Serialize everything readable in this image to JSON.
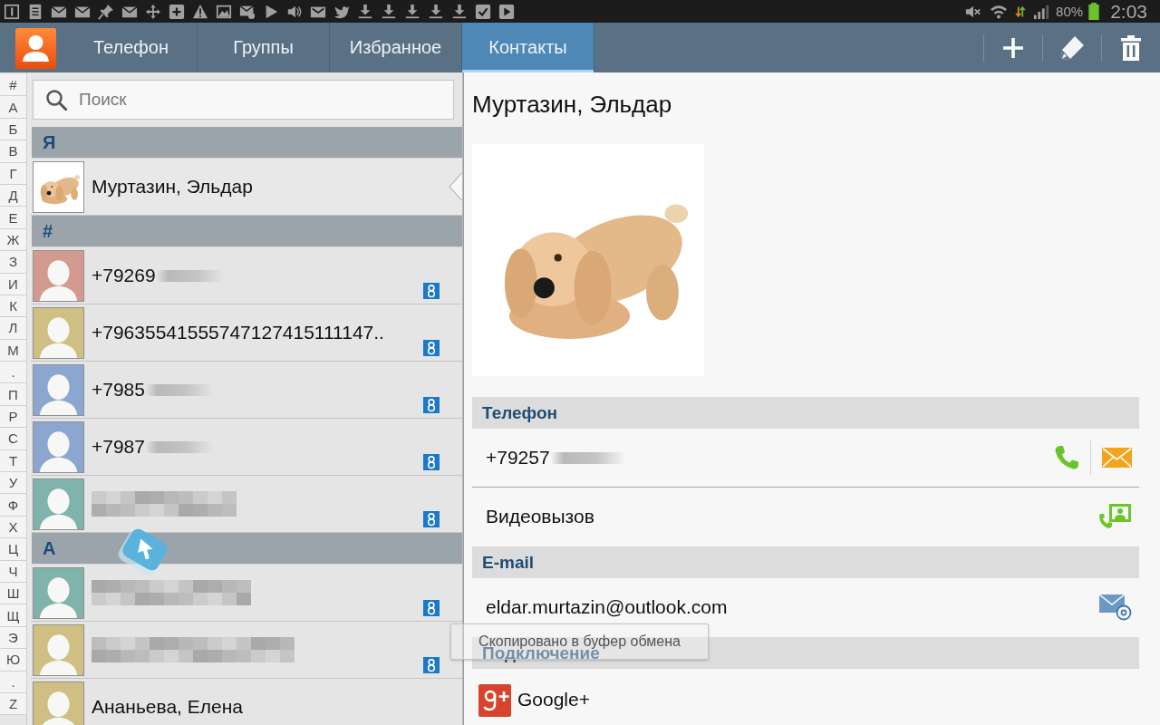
{
  "status_bar": {
    "battery": "80%",
    "time": "2:03"
  },
  "action_bar": {
    "tabs": [
      {
        "label": "Телефон",
        "selected": false
      },
      {
        "label": "Группы",
        "selected": false
      },
      {
        "label": "Избранное",
        "selected": false
      },
      {
        "label": "Контакты",
        "selected": true
      }
    ]
  },
  "index_bar": {
    "letters": [
      "#",
      "А",
      "Б",
      "В",
      "Г",
      "Д",
      "Е",
      "Ж",
      "З",
      "И",
      "К",
      "Л",
      "М",
      ".",
      "П",
      "Р",
      "С",
      "Т",
      "У",
      "Ф",
      "Х",
      "Ц",
      "Ч",
      "Ш",
      "Щ",
      "Э",
      "Ю",
      ".",
      "Z"
    ]
  },
  "contact_list": {
    "search": {
      "placeholder": "Поиск"
    },
    "sections": [
      {
        "header": "Я",
        "contacts": [
          {
            "kind": "photo",
            "name": "Муртазин, Эльдар",
            "blurred": false,
            "pixelated": false,
            "google": false,
            "selected": true
          }
        ]
      },
      {
        "header": "#",
        "contacts": [
          {
            "kind": "silhouette",
            "color": "#d39a8f",
            "name": "+79269",
            "blurred": true,
            "pixelated": false,
            "google": true,
            "selected": false
          },
          {
            "kind": "silhouette",
            "color": "#cfbf83",
            "name": "+79635541555747127415111147..",
            "blurred": false,
            "pixelated": false,
            "google": true,
            "selected": false
          },
          {
            "kind": "silhouette",
            "color": "#8ca7cf",
            "name": "+7985",
            "blurred": true,
            "pixelated": false,
            "google": true,
            "selected": false
          },
          {
            "kind": "silhouette",
            "color": "#8ca7cf",
            "name": "+7987",
            "blurred": true,
            "pixelated": false,
            "google": true,
            "selected": false
          },
          {
            "kind": "silhouette",
            "color": "#80b3ab",
            "blurred": false,
            "pixelated": true,
            "google": true,
            "selected": false
          }
        ]
      },
      {
        "header": "А",
        "contacts": [
          {
            "kind": "silhouette",
            "color": "#80b3ab",
            "blurred": false,
            "pixelated": true,
            "google": true,
            "selected": false
          },
          {
            "kind": "silhouette",
            "color": "#cfbf83",
            "blurred": false,
            "pixelated": true,
            "google": true,
            "selected": false
          },
          {
            "kind": "silhouette",
            "color": "#cfbf83",
            "name": "Ананьева, Елена",
            "blurred": false,
            "pixelated": false,
            "google": false,
            "selected": false
          }
        ]
      }
    ]
  },
  "contact_detail": {
    "title": "Муртазин, Эльдар",
    "sections": [
      {
        "title": "Телефон",
        "items": [
          {
            "kind": "phone",
            "value": "+79257",
            "blurred": true
          },
          {
            "kind": "video_call",
            "value": "Видеовызов",
            "blurred": false
          }
        ]
      },
      {
        "title": "E-mail",
        "items": [
          {
            "kind": "email",
            "value": "eldar.murtazin@outlook.com",
            "blurred": false
          }
        ]
      },
      {
        "title": "Подключение",
        "items": [
          {
            "kind": "google_plus",
            "value": "Google+",
            "blurred": false
          }
        ]
      }
    ]
  },
  "toast": {
    "message": "Скопировано в буфер обмена"
  }
}
